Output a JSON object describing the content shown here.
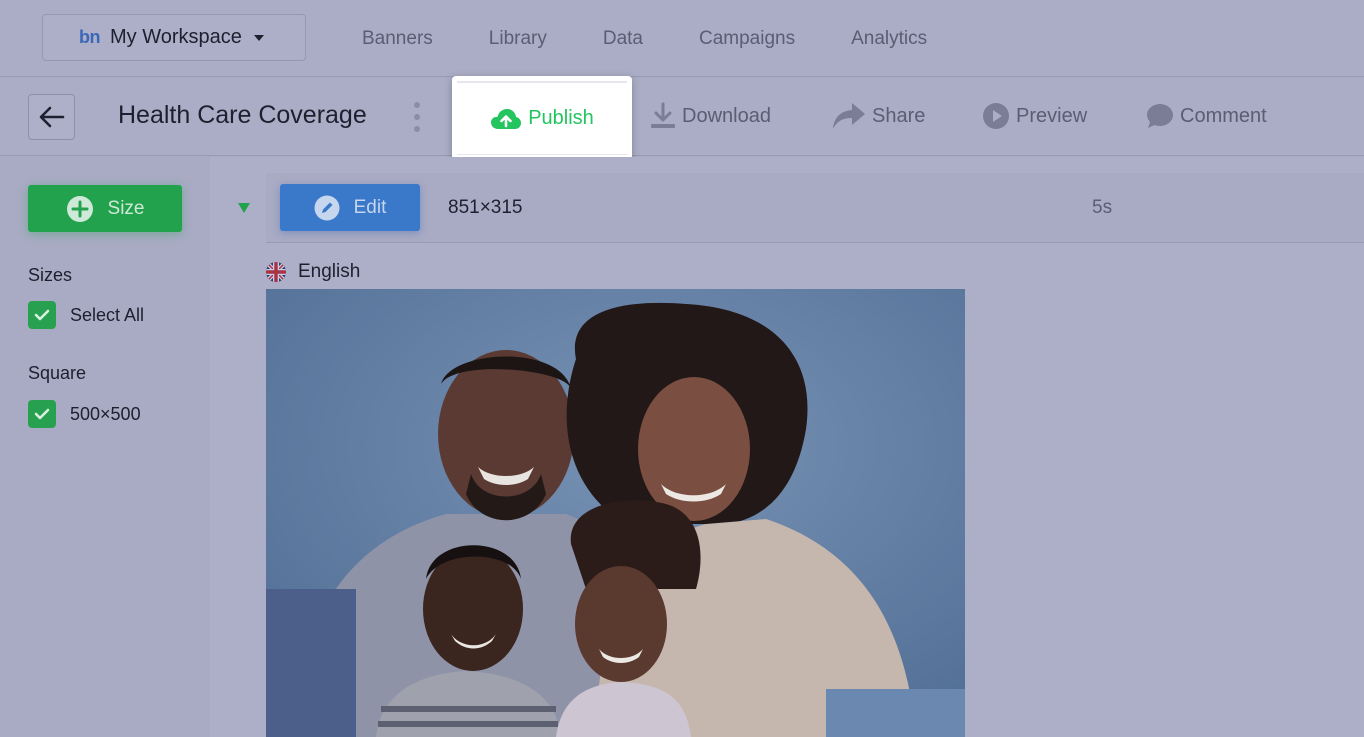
{
  "workspace": {
    "logo": "bn",
    "name": "My Workspace"
  },
  "nav": [
    "Banners",
    "Library",
    "Data",
    "Campaigns",
    "Analytics"
  ],
  "toolbar": {
    "title": "Health Care Coverage",
    "publish": "Publish",
    "download": "Download",
    "share": "Share",
    "preview": "Preview",
    "comment": "Comment"
  },
  "sidebar": {
    "size_button": "Size",
    "sizes_heading": "Sizes",
    "select_all": "Select All",
    "square_heading": "Square",
    "square_size": "500×500"
  },
  "banner_row": {
    "edit_label": "Edit",
    "dimensions": "851×315",
    "duration": "5s",
    "language": "English"
  },
  "colors": {
    "publish_green": "#22c55e",
    "size_button_green": "#22a24d",
    "edit_button_blue": "#3a78c9"
  },
  "icons": {
    "back": "arrow-left-icon",
    "publish": "cloud-upload-icon",
    "download": "download-icon",
    "share": "share-arrow-icon",
    "preview": "play-circle-icon",
    "comment": "comment-bubble-icon",
    "size": "plus-circle-icon",
    "edit": "pencil-circle-icon",
    "language": "uk-flag-icon"
  }
}
